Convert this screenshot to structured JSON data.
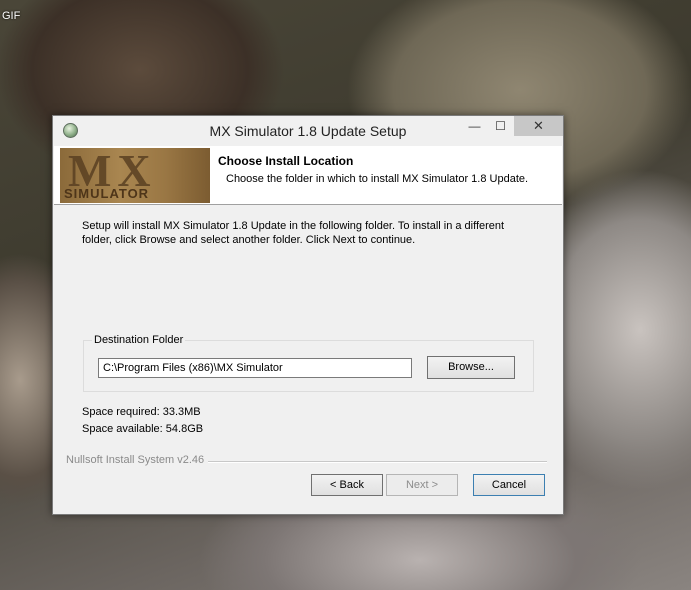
{
  "desktop": {
    "label": "GIF"
  },
  "window": {
    "title": "MX Simulator 1.8 Update Setup",
    "controls": {
      "minimize": "—",
      "maximize": "☐",
      "close": "✕"
    }
  },
  "header": {
    "logo_text_main": "MX",
    "logo_text_sub": "SIMULATOR",
    "title": "Choose Install Location",
    "subtitle": "Choose the folder in which to install MX Simulator 1.8 Update."
  },
  "body": {
    "description": "Setup will install MX Simulator 1.8 Update in the following folder. To install in a different folder, click Browse and select another folder. Click Next to continue.",
    "destination": {
      "label": "Destination Folder",
      "path": "C:\\Program Files (x86)\\MX Simulator",
      "browse_label": "Browse..."
    },
    "space_required": "Space required: 33.3MB",
    "space_available": "Space available: 54.8GB"
  },
  "footer": {
    "branding": "Nullsoft Install System v2.46",
    "back_label": "< Back",
    "next_label": "Next >",
    "cancel_label": "Cancel"
  }
}
